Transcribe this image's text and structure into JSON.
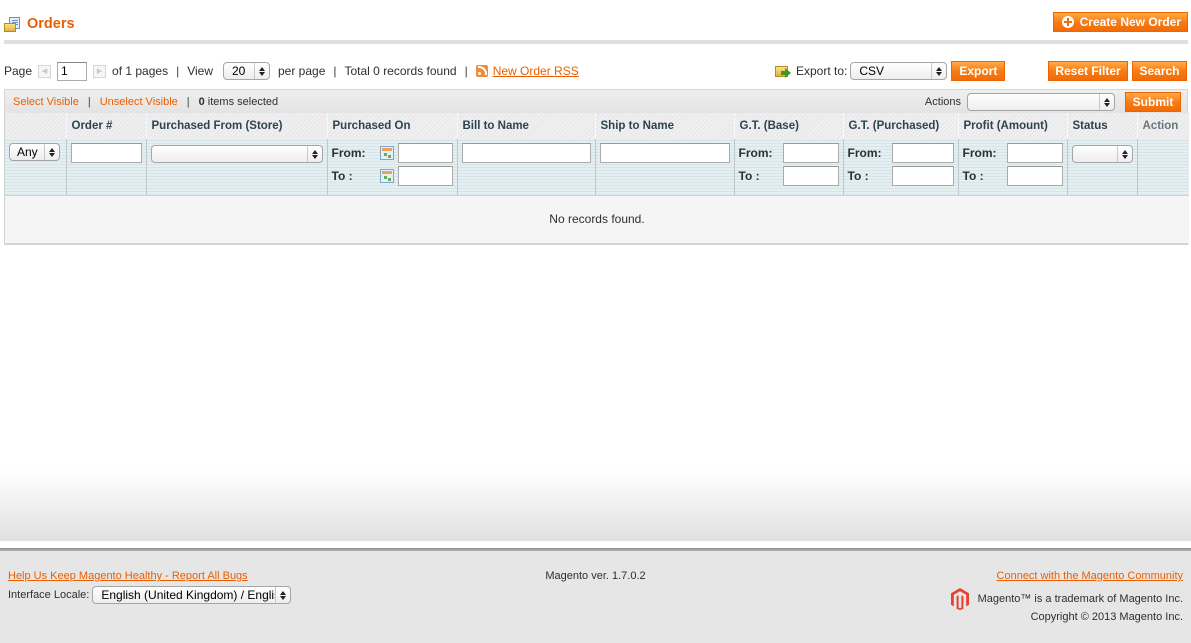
{
  "header": {
    "title": "Orders",
    "icon": "orders-icon",
    "create_button": "Create New Order"
  },
  "pager": {
    "page_label": "Page",
    "current_page": "1",
    "of_pages": "of 1 pages",
    "view_label": "View",
    "per_page_value": "20",
    "per_page_label": "per page",
    "total": "Total 0 records found",
    "rss_link": "New Order RSS"
  },
  "export": {
    "label": "Export to:",
    "format": "CSV",
    "button": "Export"
  },
  "filter_actions": {
    "reset": "Reset Filter",
    "search": "Search"
  },
  "massaction": {
    "select_visible": "Select Visible",
    "unselect_visible": "Unselect Visible",
    "selected_count": "0",
    "selected_suffix": " items selected",
    "actions_label": "Actions",
    "actions_value": "",
    "submit": "Submit"
  },
  "grid": {
    "columns": [
      {
        "label": ""
      },
      {
        "label": "Order #"
      },
      {
        "label": "Purchased From (Store)"
      },
      {
        "label": "Purchased On"
      },
      {
        "label": "Bill to Name"
      },
      {
        "label": "Ship to Name"
      },
      {
        "label": "G.T. (Base)"
      },
      {
        "label": "G.T. (Purchased)"
      },
      {
        "label": "Profit (Amount)"
      },
      {
        "label": "Status"
      },
      {
        "label": "Action"
      }
    ],
    "filters": {
      "massaction_select": "Any",
      "order_number": "",
      "store": "",
      "from_label": "From:",
      "to_label": "To :",
      "status": ""
    },
    "empty_message": "No records found."
  },
  "footer": {
    "bug_link": "Help Us Keep Magento Healthy - Report All Bugs",
    "locale_label": "Interface Locale:",
    "locale_value": "English (United Kingdom) / English (United Kingdom)",
    "version": "Magento ver. 1.7.0.2",
    "community_link": "Connect with the Magento Community",
    "trademark": "Magento™ is a trademark of Magento Inc.",
    "copyright": "Copyright © 2013 Magento Inc."
  },
  "colors": {
    "accent": "#eb5e00",
    "button_orange": "#f77c16",
    "filter_bg": "#e3eff1",
    "footer_bg": "#e6e6e6"
  }
}
